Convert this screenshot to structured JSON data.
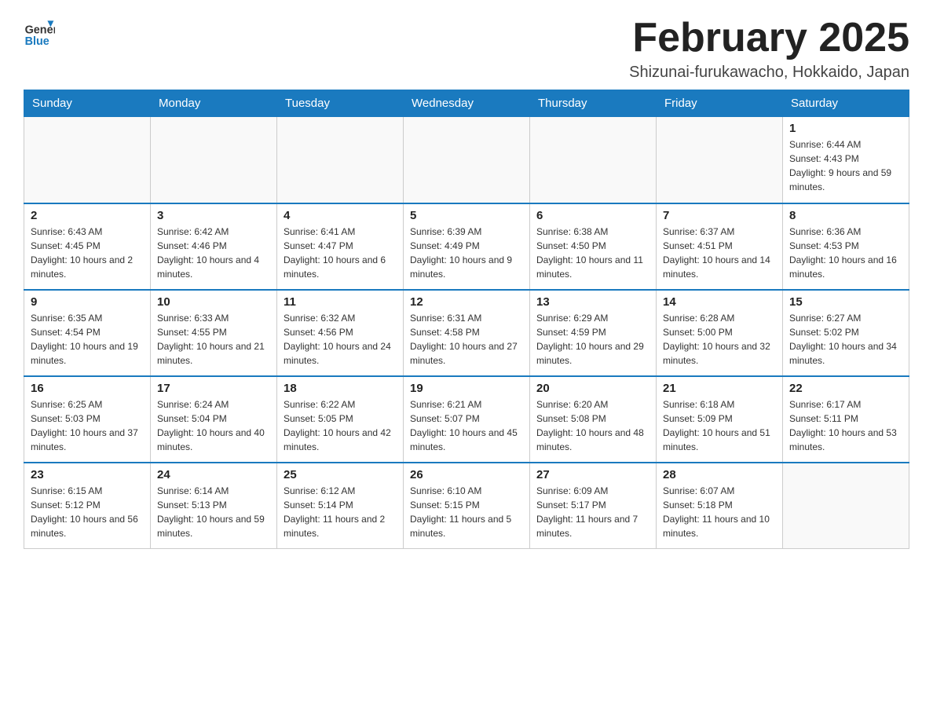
{
  "logo": {
    "general": "General",
    "blue": "Blue"
  },
  "header": {
    "month": "February 2025",
    "location": "Shizunai-furukawacho, Hokkaido, Japan"
  },
  "weekdays": [
    "Sunday",
    "Monday",
    "Tuesday",
    "Wednesday",
    "Thursday",
    "Friday",
    "Saturday"
  ],
  "weeks": [
    [
      {
        "day": "",
        "info": ""
      },
      {
        "day": "",
        "info": ""
      },
      {
        "day": "",
        "info": ""
      },
      {
        "day": "",
        "info": ""
      },
      {
        "day": "",
        "info": ""
      },
      {
        "day": "",
        "info": ""
      },
      {
        "day": "1",
        "info": "Sunrise: 6:44 AM\nSunset: 4:43 PM\nDaylight: 9 hours and 59 minutes."
      }
    ],
    [
      {
        "day": "2",
        "info": "Sunrise: 6:43 AM\nSunset: 4:45 PM\nDaylight: 10 hours and 2 minutes."
      },
      {
        "day": "3",
        "info": "Sunrise: 6:42 AM\nSunset: 4:46 PM\nDaylight: 10 hours and 4 minutes."
      },
      {
        "day": "4",
        "info": "Sunrise: 6:41 AM\nSunset: 4:47 PM\nDaylight: 10 hours and 6 minutes."
      },
      {
        "day": "5",
        "info": "Sunrise: 6:39 AM\nSunset: 4:49 PM\nDaylight: 10 hours and 9 minutes."
      },
      {
        "day": "6",
        "info": "Sunrise: 6:38 AM\nSunset: 4:50 PM\nDaylight: 10 hours and 11 minutes."
      },
      {
        "day": "7",
        "info": "Sunrise: 6:37 AM\nSunset: 4:51 PM\nDaylight: 10 hours and 14 minutes."
      },
      {
        "day": "8",
        "info": "Sunrise: 6:36 AM\nSunset: 4:53 PM\nDaylight: 10 hours and 16 minutes."
      }
    ],
    [
      {
        "day": "9",
        "info": "Sunrise: 6:35 AM\nSunset: 4:54 PM\nDaylight: 10 hours and 19 minutes."
      },
      {
        "day": "10",
        "info": "Sunrise: 6:33 AM\nSunset: 4:55 PM\nDaylight: 10 hours and 21 minutes."
      },
      {
        "day": "11",
        "info": "Sunrise: 6:32 AM\nSunset: 4:56 PM\nDaylight: 10 hours and 24 minutes."
      },
      {
        "day": "12",
        "info": "Sunrise: 6:31 AM\nSunset: 4:58 PM\nDaylight: 10 hours and 27 minutes."
      },
      {
        "day": "13",
        "info": "Sunrise: 6:29 AM\nSunset: 4:59 PM\nDaylight: 10 hours and 29 minutes."
      },
      {
        "day": "14",
        "info": "Sunrise: 6:28 AM\nSunset: 5:00 PM\nDaylight: 10 hours and 32 minutes."
      },
      {
        "day": "15",
        "info": "Sunrise: 6:27 AM\nSunset: 5:02 PM\nDaylight: 10 hours and 34 minutes."
      }
    ],
    [
      {
        "day": "16",
        "info": "Sunrise: 6:25 AM\nSunset: 5:03 PM\nDaylight: 10 hours and 37 minutes."
      },
      {
        "day": "17",
        "info": "Sunrise: 6:24 AM\nSunset: 5:04 PM\nDaylight: 10 hours and 40 minutes."
      },
      {
        "day": "18",
        "info": "Sunrise: 6:22 AM\nSunset: 5:05 PM\nDaylight: 10 hours and 42 minutes."
      },
      {
        "day": "19",
        "info": "Sunrise: 6:21 AM\nSunset: 5:07 PM\nDaylight: 10 hours and 45 minutes."
      },
      {
        "day": "20",
        "info": "Sunrise: 6:20 AM\nSunset: 5:08 PM\nDaylight: 10 hours and 48 minutes."
      },
      {
        "day": "21",
        "info": "Sunrise: 6:18 AM\nSunset: 5:09 PM\nDaylight: 10 hours and 51 minutes."
      },
      {
        "day": "22",
        "info": "Sunrise: 6:17 AM\nSunset: 5:11 PM\nDaylight: 10 hours and 53 minutes."
      }
    ],
    [
      {
        "day": "23",
        "info": "Sunrise: 6:15 AM\nSunset: 5:12 PM\nDaylight: 10 hours and 56 minutes."
      },
      {
        "day": "24",
        "info": "Sunrise: 6:14 AM\nSunset: 5:13 PM\nDaylight: 10 hours and 59 minutes."
      },
      {
        "day": "25",
        "info": "Sunrise: 6:12 AM\nSunset: 5:14 PM\nDaylight: 11 hours and 2 minutes."
      },
      {
        "day": "26",
        "info": "Sunrise: 6:10 AM\nSunset: 5:15 PM\nDaylight: 11 hours and 5 minutes."
      },
      {
        "day": "27",
        "info": "Sunrise: 6:09 AM\nSunset: 5:17 PM\nDaylight: 11 hours and 7 minutes."
      },
      {
        "day": "28",
        "info": "Sunrise: 6:07 AM\nSunset: 5:18 PM\nDaylight: 11 hours and 10 minutes."
      },
      {
        "day": "",
        "info": ""
      }
    ]
  ],
  "colors": {
    "header_bg": "#1a7abf",
    "header_text": "#ffffff",
    "border": "#1a7abf"
  }
}
